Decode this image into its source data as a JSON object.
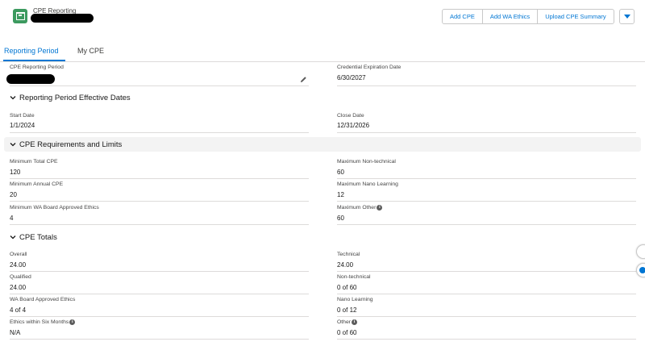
{
  "header": {
    "title": "CPE Reporting",
    "actions": [
      "Add CPE",
      "Add WA Ethics",
      "Upload CPE Summary"
    ]
  },
  "tabs": [
    "Reporting Period",
    "My CPE"
  ],
  "period": {
    "left_label": "CPE Reporting Period",
    "right_label": "Credential Expiration Date",
    "right_value": "6/30/2027"
  },
  "sections": {
    "dates_title": "Reporting Period Effective Dates",
    "reqs_title": "CPE Requirements and Limits",
    "totals_title": "CPE Totals"
  },
  "dates": {
    "start_label": "Start Date",
    "start_value": "1/1/2024",
    "close_label": "Close Date",
    "close_value": "12/31/2026"
  },
  "requirements": [
    {
      "label": "Minimum Total CPE",
      "value": "120"
    },
    {
      "label": "Maximum Non-technical",
      "value": "60"
    },
    {
      "label": "Minimum Annual CPE",
      "value": "20"
    },
    {
      "label": "Maximum Nano Learning",
      "value": "12"
    },
    {
      "label": "Minimum WA Board Approved Ethics",
      "value": "4"
    },
    {
      "label": "Maximum Other",
      "value": "60"
    }
  ],
  "totals": [
    {
      "label": "Overall",
      "value": "24.00"
    },
    {
      "label": "Technical",
      "value": "24.00"
    },
    {
      "label": "Qualified",
      "value": "24.00"
    },
    {
      "label": "Non-technical",
      "value": "0 of 60"
    },
    {
      "label": "WA Board Approved Ethics",
      "value": "4 of 4"
    },
    {
      "label": "Nano Learning",
      "value": "0 of 12"
    },
    {
      "label": "Ethics within Six Months",
      "value": "N/A"
    },
    {
      "label": "Other",
      "value": "0 of 60"
    }
  ],
  "colors": {
    "accent": "#0176d3",
    "app_icon": "#3c9a5f",
    "section_bg": "#f3f3f3"
  }
}
